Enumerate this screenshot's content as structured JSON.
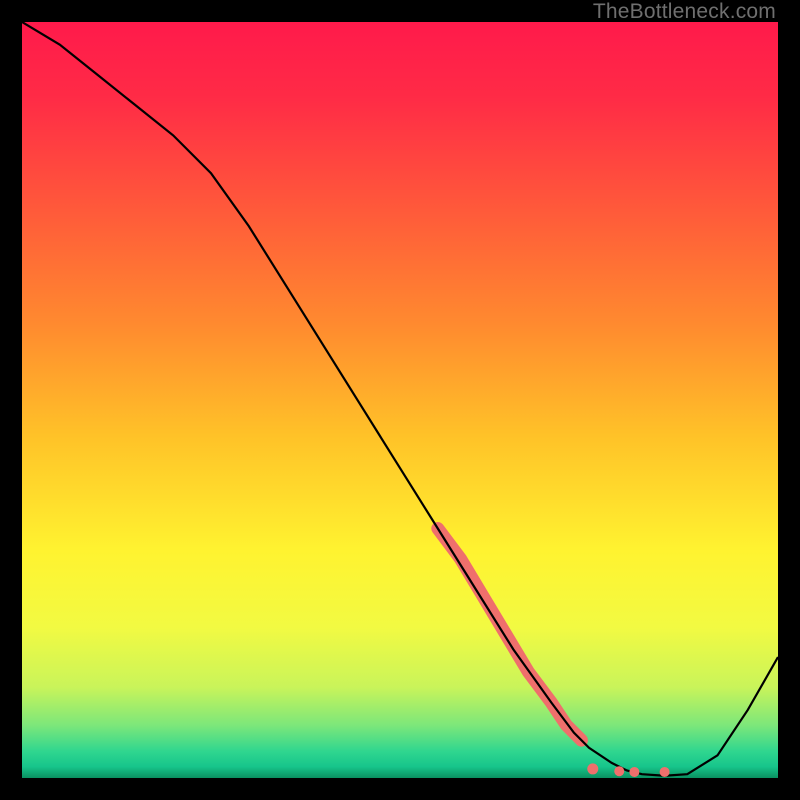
{
  "watermark": "TheBottleneck.com",
  "chart_data": {
    "type": "line",
    "title": "",
    "xlabel": "",
    "ylabel": "",
    "xlim": [
      0,
      100
    ],
    "ylim": [
      0,
      100
    ],
    "grid": false,
    "legend": false,
    "curve": {
      "name": "bottleneck-curve",
      "color": "#000000",
      "x": [
        0,
        5,
        10,
        15,
        20,
        25,
        30,
        35,
        40,
        45,
        50,
        55,
        60,
        65,
        70,
        73,
        75,
        78,
        80,
        82,
        85,
        88,
        92,
        96,
        100
      ],
      "y": [
        100,
        97,
        93,
        89,
        85,
        80,
        73,
        65,
        57,
        49,
        41,
        33,
        25,
        17,
        10,
        6,
        4,
        2,
        1,
        0.5,
        0.3,
        0.5,
        3,
        9,
        16
      ]
    },
    "highlight_segment": {
      "name": "highlight",
      "color": "#ef6f6c",
      "width_profile": "tapered",
      "x": [
        55,
        58,
        61,
        64,
        67,
        70,
        72,
        74
      ],
      "y": [
        33,
        29,
        24,
        19,
        14,
        10,
        7,
        5
      ]
    },
    "highlight_dots": {
      "name": "dots",
      "color": "#ef6f6c",
      "points": [
        {
          "x": 75.5,
          "y": 1.2
        },
        {
          "x": 79,
          "y": 0.9
        },
        {
          "x": 81,
          "y": 0.8
        },
        {
          "x": 85,
          "y": 0.8
        }
      ]
    },
    "gradient_stops": [
      {
        "offset": 0.0,
        "color": "#ff1a4b"
      },
      {
        "offset": 0.1,
        "color": "#ff2b46"
      },
      {
        "offset": 0.25,
        "color": "#ff5a3a"
      },
      {
        "offset": 0.4,
        "color": "#ff8a2f"
      },
      {
        "offset": 0.55,
        "color": "#ffc328"
      },
      {
        "offset": 0.7,
        "color": "#fff330"
      },
      {
        "offset": 0.8,
        "color": "#f2fa42"
      },
      {
        "offset": 0.88,
        "color": "#c9f45a"
      },
      {
        "offset": 0.93,
        "color": "#7de77a"
      },
      {
        "offset": 0.965,
        "color": "#2fd68f"
      },
      {
        "offset": 0.985,
        "color": "#17c58b"
      },
      {
        "offset": 1.0,
        "color": "#0a9060"
      }
    ]
  }
}
